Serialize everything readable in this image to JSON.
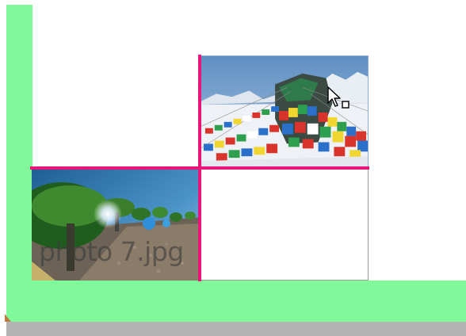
{
  "canvas": {
    "colors": {
      "background": "#ffffff",
      "green_panel": "#80f99a",
      "bottom_bar": "#b3b3b3",
      "guide_lines": "#e8157a",
      "selection_border": "#8da7e0"
    }
  },
  "grid": {
    "cells": [
      {
        "name": "prayer-flags-image",
        "kind": "image"
      },
      {
        "name": "photo-7-cell",
        "kind": "image",
        "label": "photo 7.jpg"
      },
      {
        "name": "empty-cell",
        "kind": "empty"
      }
    ]
  },
  "cursor": {
    "icon": "arrow-cursor-icon",
    "badge": "drop-copy-icon"
  }
}
